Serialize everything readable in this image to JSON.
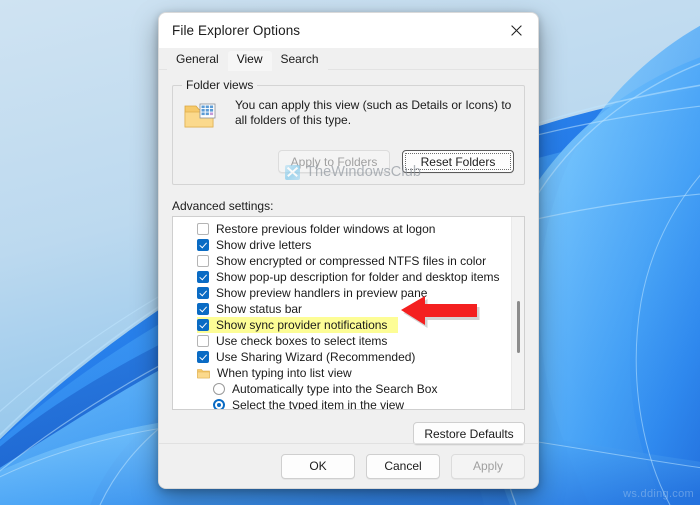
{
  "window": {
    "title": "File Explorer Options",
    "close_icon": "close-icon"
  },
  "tabs": [
    {
      "label": "General",
      "active": false
    },
    {
      "label": "View",
      "active": true
    },
    {
      "label": "Search",
      "active": false
    }
  ],
  "folder_views": {
    "legend": "Folder views",
    "icon": "folder-view-icon",
    "description": "You can apply this view (such as Details or Icons) to all folders of this type.",
    "apply_button": "Apply to Folders",
    "apply_disabled": true,
    "reset_button": "Reset Folders",
    "reset_focused": true
  },
  "watermark": {
    "text": "TheWindowsClub",
    "logo": "thewindowsclub-logo"
  },
  "advanced": {
    "label": "Advanced settings:",
    "items": [
      {
        "type": "checkbox",
        "checked": false,
        "label": "Restore previous folder windows at logon",
        "highlighted": false,
        "indent": false
      },
      {
        "type": "checkbox",
        "checked": true,
        "label": "Show drive letters",
        "highlighted": false,
        "indent": false
      },
      {
        "type": "checkbox",
        "checked": false,
        "label": "Show encrypted or compressed NTFS files in color",
        "highlighted": false,
        "indent": false
      },
      {
        "type": "checkbox",
        "checked": true,
        "label": "Show pop-up description for folder and desktop items",
        "highlighted": false,
        "indent": false
      },
      {
        "type": "checkbox",
        "checked": true,
        "label": "Show preview handlers in preview pane",
        "highlighted": false,
        "indent": false
      },
      {
        "type": "checkbox",
        "checked": true,
        "label": "Show status bar",
        "highlighted": false,
        "indent": false
      },
      {
        "type": "checkbox",
        "checked": true,
        "label": "Show sync provider notifications",
        "highlighted": true,
        "indent": false
      },
      {
        "type": "checkbox",
        "checked": false,
        "label": "Use check boxes to select items",
        "highlighted": false,
        "indent": false
      },
      {
        "type": "checkbox",
        "checked": true,
        "label": "Use Sharing Wizard (Recommended)",
        "highlighted": false,
        "indent": false
      },
      {
        "type": "folder",
        "checked": false,
        "label": "When typing into list view",
        "highlighted": false,
        "indent": false
      },
      {
        "type": "radio",
        "checked": false,
        "label": "Automatically type into the Search Box",
        "highlighted": false,
        "indent": true
      },
      {
        "type": "radio",
        "checked": true,
        "label": "Select the typed item in the view",
        "highlighted": false,
        "indent": true
      }
    ],
    "scrollbar": "vertical-scrollbar"
  },
  "restore_defaults_button": "Restore Defaults",
  "footer": {
    "ok": "OK",
    "cancel": "Cancel",
    "apply": "Apply",
    "apply_disabled": true
  },
  "annotation": {
    "arrow": "red-pointer-arrow",
    "color": "#f42020"
  },
  "corner_watermark": "ws.dding.com",
  "colors": {
    "accent": "#0a6bc4",
    "highlight": "#fdfd96",
    "dialog_bg": "#f0f0f0",
    "titlebar": "#ffffff"
  }
}
